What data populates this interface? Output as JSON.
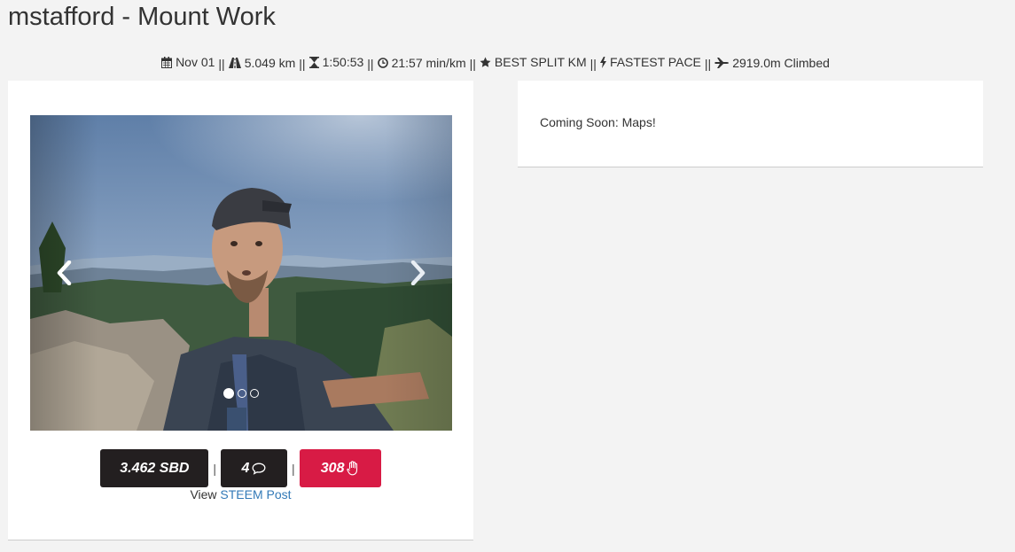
{
  "page": {
    "title": "mstafford - Mount Work"
  },
  "stats": {
    "date": "Nov 01",
    "distance": "5.049 km",
    "duration": "1:50:53",
    "pace": "21:57 min/km",
    "best_split": "BEST SPLIT KM",
    "fastest_pace": "FASTEST PACE",
    "climbed": "2919.0m Climbed",
    "separator": "||",
    "icons": [
      "calendar-icon",
      "road-icon",
      "hourglass-icon",
      "clock-icon",
      "star-icon",
      "bolt-icon",
      "plane-icon"
    ]
  },
  "carousel": {
    "slide_count": 3,
    "active_index": 0,
    "image_description": "selfie on a rocky hilltop"
  },
  "buttons": {
    "sbd_label": "3.462 SBD",
    "comments_count": "4",
    "votes_count": "308",
    "divider": "|"
  },
  "link": {
    "prefix": "View",
    "text": "STEEM Post"
  },
  "right_panel": {
    "message": "Coming Soon: Maps!"
  },
  "colors": {
    "dark_button": "#231f20",
    "vote_button": "#d81b45",
    "link": "#337ab7",
    "background": "#f3f3f3"
  }
}
